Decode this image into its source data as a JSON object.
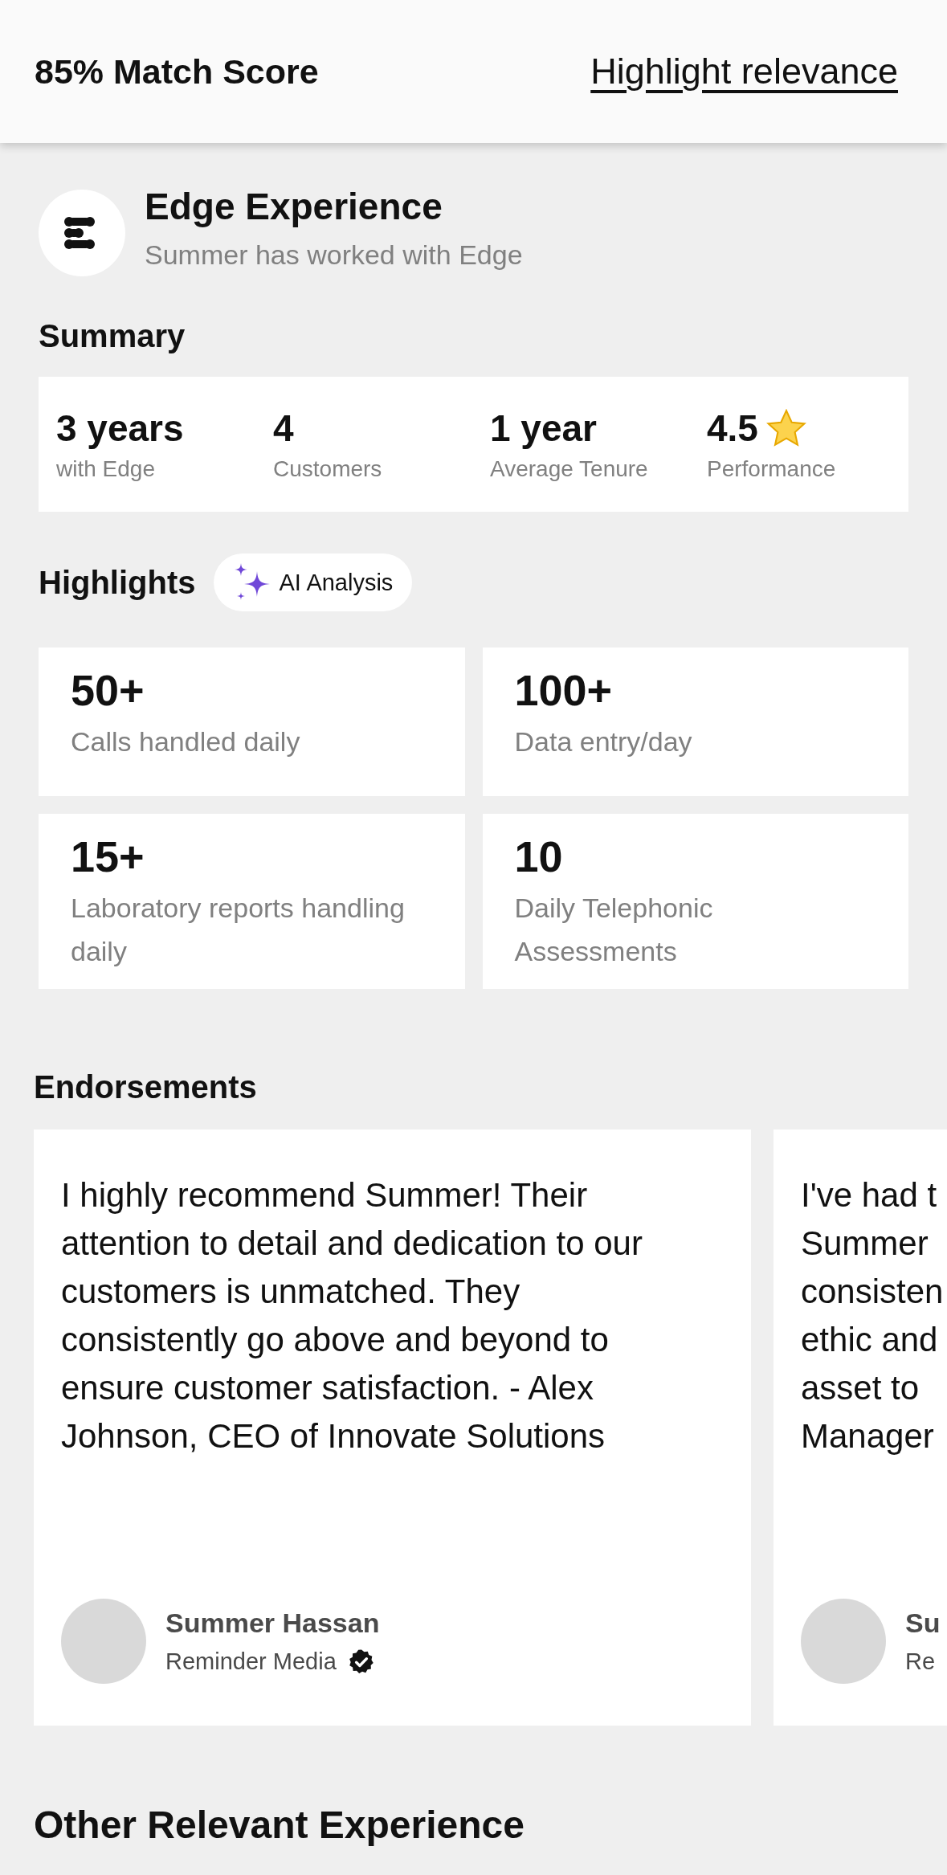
{
  "header": {
    "score": "85% Match Score",
    "link": "Highlight relevance"
  },
  "company": {
    "name": "Edge Experience",
    "subtitle": "Summer has worked with Edge"
  },
  "summary": {
    "title": "Summary",
    "stats": [
      {
        "kind": "plain",
        "value": "3 years",
        "label": "with Edge"
      },
      {
        "kind": "plain",
        "value": "4",
        "label": "Customers"
      },
      {
        "kind": "plain",
        "value": "1 year",
        "label": "Average Tenure"
      },
      {
        "kind": "rating",
        "value": "4.5",
        "label": "Performance"
      }
    ]
  },
  "highlights": {
    "title": "Highlights",
    "badge": "AI Analysis",
    "items": [
      {
        "value": "50+",
        "label": "Calls handled daily"
      },
      {
        "value": "100+",
        "label": "Data entry/day"
      },
      {
        "value": "15+",
        "label": "Laboratory reports handling daily"
      },
      {
        "value": "10",
        "label": "Daily Telephonic Assessments"
      }
    ]
  },
  "endorsements": {
    "title": "Endorsements",
    "items": [
      {
        "text": "I highly recommend Summer! Their attention to detail and dedication to our customers is unmatched. They consistently go above and beyond to ensure customer satisfaction. - Alex Johnson, CEO of Innovate Solutions",
        "name": "Summer Hassan",
        "company": "Reminder Media",
        "verified": true
      },
      {
        "text": "I've had t\nSummer\nconsisten\nethic and\nasset to\nManager",
        "name": "Su",
        "company": "Re"
      }
    ]
  },
  "other": {
    "title": "Other Relevant Experience"
  }
}
